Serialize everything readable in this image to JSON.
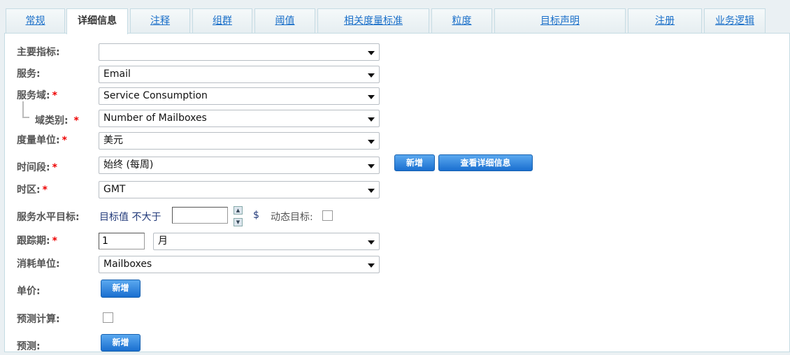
{
  "tabs": [
    "常规",
    "详细信息",
    "注释",
    "组群",
    "阈值",
    "相关度量标准",
    "粒度",
    "目标声明",
    "注册",
    "业务逻辑"
  ],
  "active_tab": "详细信息",
  "form": {
    "primary_metric": {
      "label": "主要指标:",
      "value": ""
    },
    "service": {
      "label": "服务:",
      "value": "Email"
    },
    "service_domain": {
      "label": "服务域:",
      "value": "Service Consumption"
    },
    "domain_category": {
      "label": "域类别:",
      "value": "Number of Mailboxes"
    },
    "unit": {
      "label": "度量单位:",
      "value": "美元"
    },
    "period": {
      "label": "时间段:",
      "value": "始终 (每周)",
      "add": "新增",
      "view_details": "查看详细信息"
    },
    "timezone": {
      "label": "时区:",
      "value": "GMT"
    },
    "sla": {
      "label": "服务水平目标:",
      "target_text": "目标值 不大于",
      "value": "",
      "currency": "$",
      "dynamic_label": "动态目标:"
    },
    "tracking": {
      "label": "跟踪期:",
      "count": "1",
      "unit": "月"
    },
    "consumption_unit": {
      "label": "消耗单位:",
      "value": "Mailboxes"
    },
    "unit_price": {
      "label": "单价:",
      "add": "新增"
    },
    "forecast_calc": {
      "label": "预测计算:"
    },
    "forecast": {
      "label": "预测:",
      "add": "新增"
    },
    "required_mark": "*"
  }
}
